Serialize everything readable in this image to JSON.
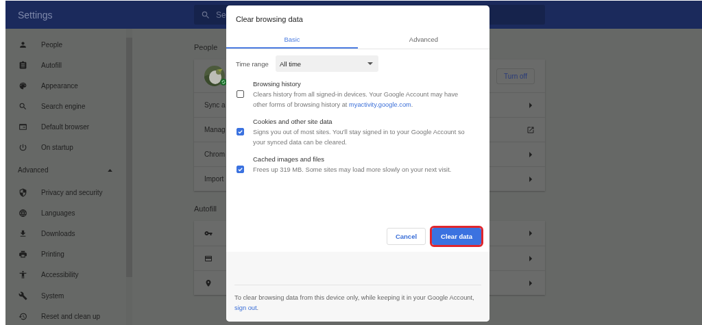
{
  "header": {
    "title": "Settings",
    "search": {
      "placeholder": "Se"
    }
  },
  "sidebar": {
    "items": [
      {
        "label": "People",
        "kind": "person"
      },
      {
        "label": "Autofill",
        "kind": "clipboard"
      },
      {
        "label": "Appearance",
        "kind": "palette"
      },
      {
        "label": "Search engine",
        "kind": "search"
      },
      {
        "label": "Default browser",
        "kind": "browser"
      },
      {
        "label": "On startup",
        "kind": "power"
      }
    ],
    "advanced": {
      "label": "Advanced",
      "expanded": true,
      "items": [
        {
          "label": "Privacy and security",
          "kind": "shield"
        },
        {
          "label": "Languages",
          "kind": "globe"
        },
        {
          "label": "Downloads",
          "kind": "download"
        },
        {
          "label": "Printing",
          "kind": "printer"
        },
        {
          "label": "Accessibility",
          "kind": "accessibility"
        },
        {
          "label": "System",
          "kind": "wrench"
        },
        {
          "label": "Reset and clean up",
          "kind": "history"
        }
      ]
    }
  },
  "sections": [
    {
      "heading": "People",
      "rows": [
        {
          "kind": "profile",
          "button": "Turn off"
        },
        {
          "kind": "arrow",
          "label": "Sync a"
        },
        {
          "kind": "external",
          "label": "Manag"
        },
        {
          "kind": "arrow",
          "label": "Chrom"
        },
        {
          "kind": "arrow",
          "label": "Import"
        }
      ]
    },
    {
      "heading": "Autofill",
      "rows": [
        {
          "kind": "key"
        },
        {
          "kind": "card"
        },
        {
          "kind": "pin"
        }
      ]
    }
  ],
  "dialog": {
    "title": "Clear browsing data",
    "tabs": [
      {
        "label": "Basic",
        "selected": true
      },
      {
        "label": "Advanced",
        "selected": false
      }
    ],
    "time_range": {
      "label": "Time range",
      "value": "All time"
    },
    "options": [
      {
        "title": "Browsing history",
        "description": "Clears history from all signed-in devices. Your Google Account may have other forms of browsing history at ",
        "link": "myactivity.google.com",
        "tail": ".",
        "checked": false
      },
      {
        "title": "Cookies and other site data",
        "description": "Signs you out of most sites. You'll stay signed in to your Google Account so your synced data can be cleared.",
        "checked": true
      },
      {
        "title": "Cached images and files",
        "description": "Frees up 319 MB. Some sites may load more slowly on your next visit.",
        "checked": true
      }
    ],
    "buttons": [
      {
        "label": "Cancel",
        "kind": "secondary",
        "highlighted": false
      },
      {
        "label": "Clear data",
        "kind": "primary",
        "highlighted": true
      }
    ],
    "footer": {
      "text": "To clear browsing data from this device only, while keeping it in your Google Account, ",
      "link": "sign out",
      "tail": "."
    }
  }
}
